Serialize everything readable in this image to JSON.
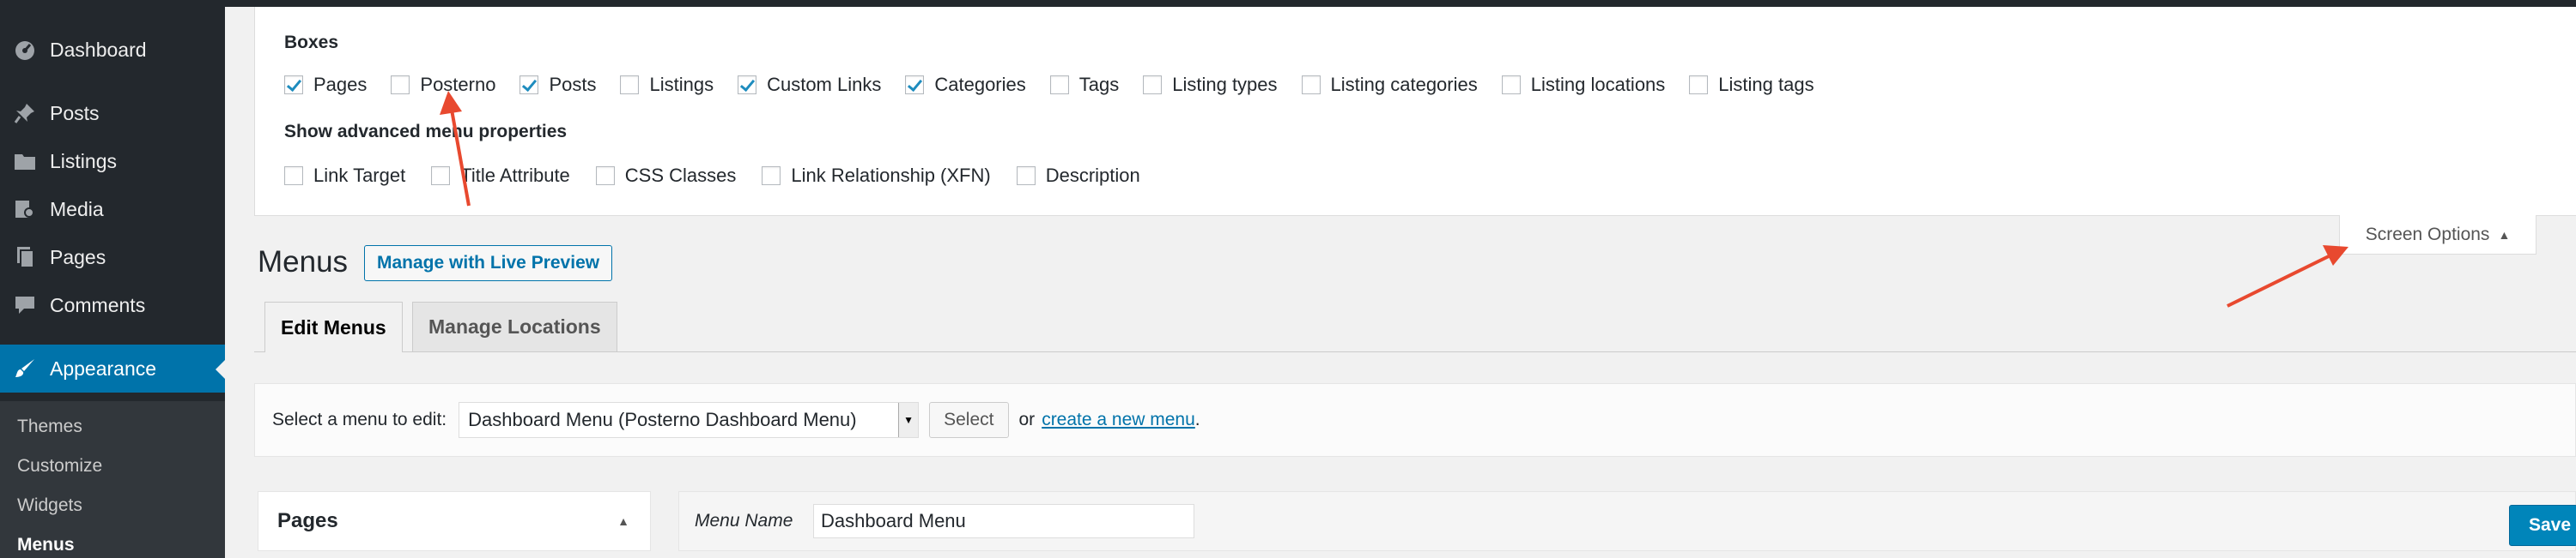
{
  "sidebar": {
    "items": [
      {
        "label": "Dashboard",
        "icon": "dashboard-icon"
      },
      {
        "label": "Posts",
        "icon": "pin-icon"
      },
      {
        "label": "Listings",
        "icon": "folder-icon"
      },
      {
        "label": "Media",
        "icon": "media-icon"
      },
      {
        "label": "Pages",
        "icon": "page-icon"
      },
      {
        "label": "Comments",
        "icon": "comment-icon"
      },
      {
        "label": "Appearance",
        "icon": "brush-icon"
      }
    ],
    "submenu": [
      "Themes",
      "Customize",
      "Widgets",
      "Menus"
    ]
  },
  "screen_options": {
    "boxes_label": "Boxes",
    "boxes": [
      {
        "label": "Pages",
        "checked": true
      },
      {
        "label": "Posterno",
        "checked": false
      },
      {
        "label": "Posts",
        "checked": true
      },
      {
        "label": "Listings",
        "checked": false
      },
      {
        "label": "Custom Links",
        "checked": true
      },
      {
        "label": "Categories",
        "checked": true
      },
      {
        "label": "Tags",
        "checked": false
      },
      {
        "label": "Listing types",
        "checked": false
      },
      {
        "label": "Listing categories",
        "checked": false
      },
      {
        "label": "Listing locations",
        "checked": false
      },
      {
        "label": "Listing tags",
        "checked": false
      }
    ],
    "advanced_label": "Show advanced menu properties",
    "advanced": [
      {
        "label": "Link Target",
        "checked": false
      },
      {
        "label": "Title Attribute",
        "checked": false
      },
      {
        "label": "CSS Classes",
        "checked": false
      },
      {
        "label": "Link Relationship (XFN)",
        "checked": false
      },
      {
        "label": "Description",
        "checked": false
      }
    ],
    "tab_label": "Screen Options"
  },
  "header": {
    "title": "Menus",
    "live_preview": "Manage with Live Preview"
  },
  "tabs": [
    {
      "label": "Edit Menus",
      "active": true
    },
    {
      "label": "Manage Locations",
      "active": false
    }
  ],
  "manage": {
    "select_label": "Select a menu to edit:",
    "selected_menu": "Dashboard Menu (Posterno Dashboard Menu)",
    "select_button": "Select",
    "or_text": "or",
    "create_link": "create a new menu",
    "period": "."
  },
  "pages_panel": {
    "title": "Pages"
  },
  "menu_edit": {
    "name_label": "Menu Name",
    "name_value": "Dashboard Menu",
    "save_label": "Save Menu"
  },
  "colors": {
    "admin_bar": "#23282d",
    "accent": "#0073aa",
    "annotation": "#e8492f"
  }
}
